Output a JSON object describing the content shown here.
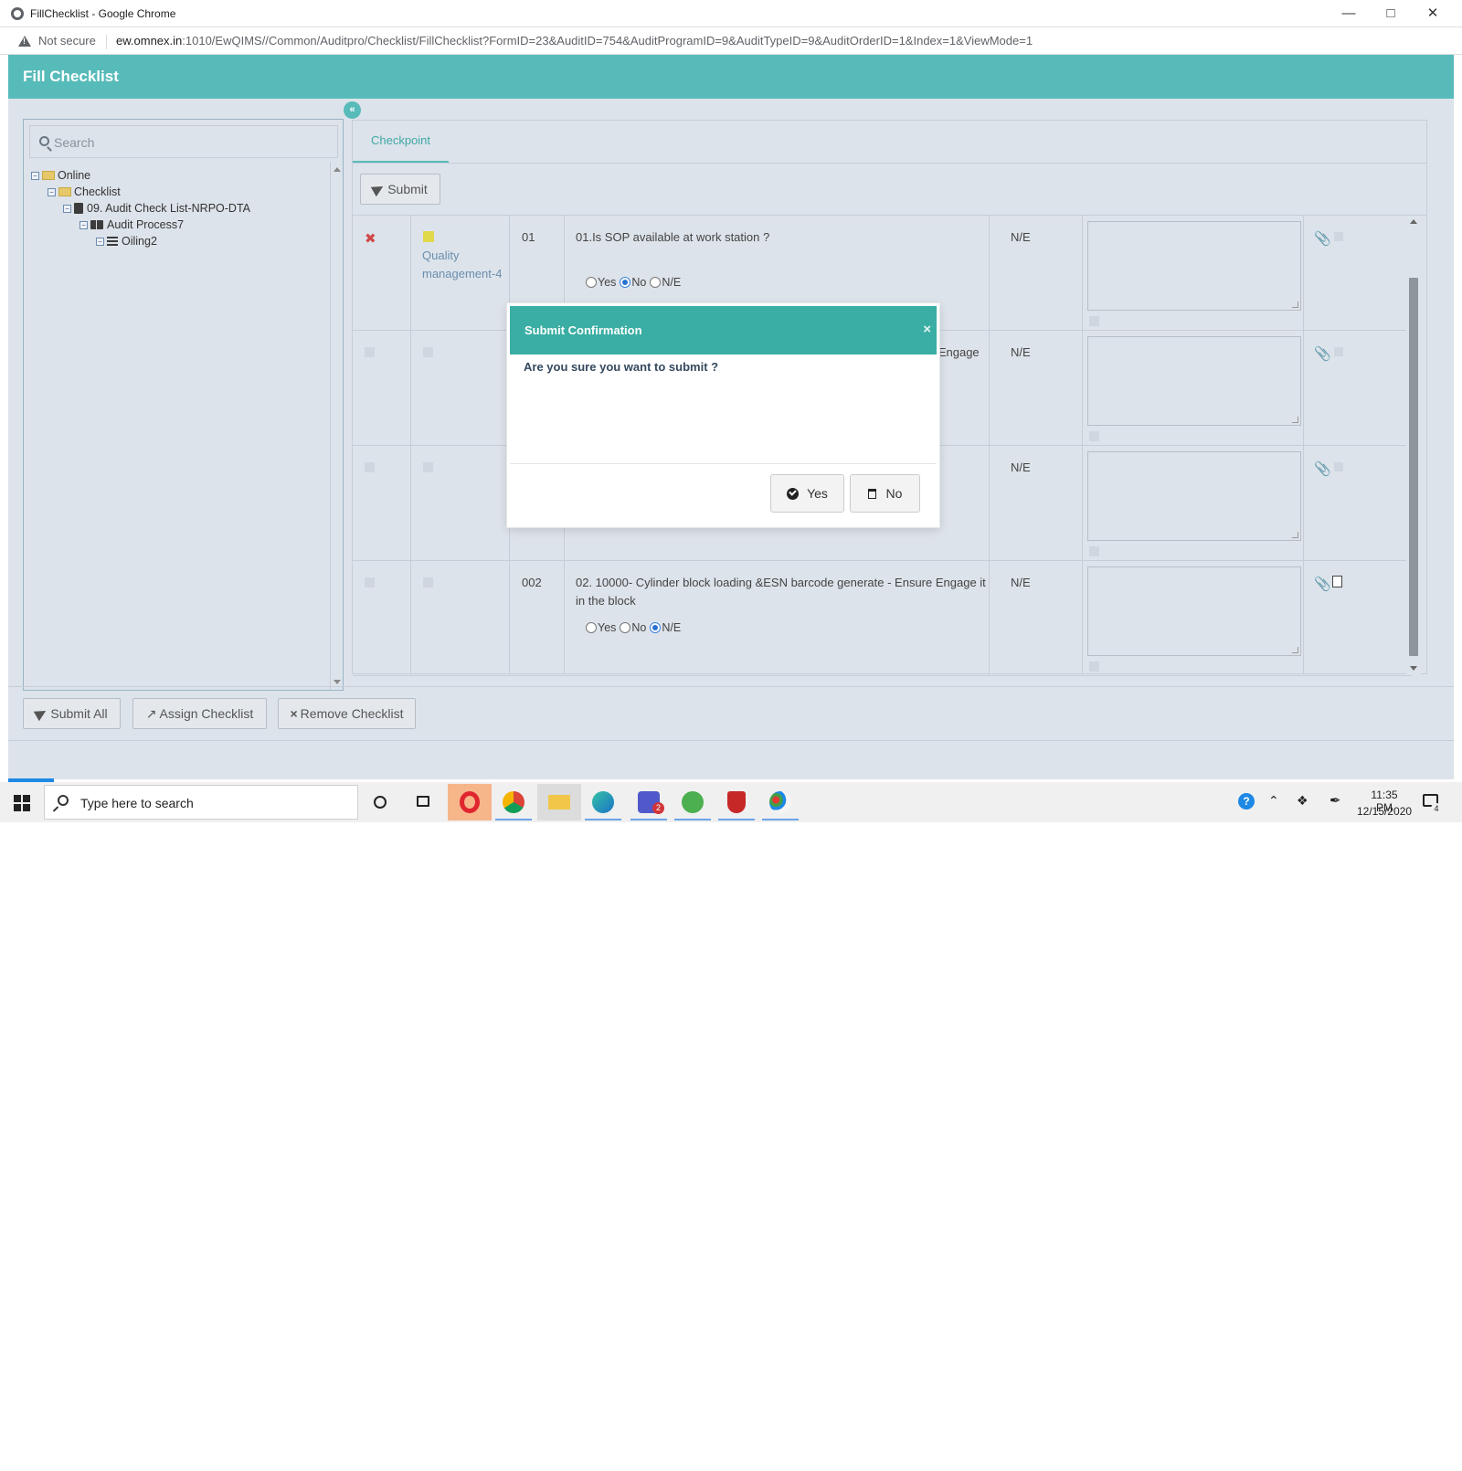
{
  "browser": {
    "window_title": "FillChecklist - Google Chrome",
    "security_label": "Not secure",
    "url_host": "ew.omnex.in",
    "url_rest": ":1010/EwQIMS//Common/Auditpro/Checklist/FillChecklist?FormID=23&AuditID=754&AuditProgramID=9&AuditTypeID=9&AuditOrderID=1&Index=1&ViewMode=1"
  },
  "app": {
    "title": "Fill Checklist",
    "collapse_glyph": "«",
    "accent_color": "#57bbba"
  },
  "sidebar": {
    "search_placeholder": "Search",
    "tree": [
      {
        "label": "Online",
        "icon": "folder-icon",
        "level": 0
      },
      {
        "label": "Checklist",
        "icon": "folder-icon",
        "level": 1
      },
      {
        "label": "09. Audit Check List-NRPO-DTA",
        "icon": "book-icon",
        "level": 2
      },
      {
        "label": "Audit Process7",
        "icon": "open-book-icon",
        "level": 3
      },
      {
        "label": "Oiling2",
        "icon": "list-icon",
        "level": 4
      }
    ]
  },
  "main": {
    "tab_label": "Checkpoint",
    "submit_label": "Submit",
    "rows": [
      {
        "seq": "01",
        "category": "Quality management-4",
        "question": "01.Is SOP available at work station ?",
        "status": "N/E",
        "selected": "No"
      },
      {
        "seq": "",
        "category": "",
        "question": "e Engage",
        "status": "N/E",
        "selected": ""
      },
      {
        "seq": "",
        "category": "",
        "question": "",
        "status": "N/E",
        "selected": ""
      },
      {
        "seq": "002",
        "category": "",
        "question": "02. 10000- Cylinder block loading &ESN barcode generate - Ensure Engage it in the block",
        "status": "N/E",
        "selected": "N/E"
      }
    ],
    "radio_labels": {
      "yes": "Yes",
      "no": "No",
      "ne": "N/E"
    }
  },
  "footer": {
    "submit_all": "Submit All",
    "assign_checklist": "Assign Checklist",
    "remove_checklist": "Remove Checklist"
  },
  "modal": {
    "title": "Submit Confirmation",
    "close": "×",
    "message": "Are you sure you want to submit ?",
    "yes_label": "Yes",
    "no_label": "No",
    "header_color": "#3aaea4"
  },
  "taskbar": {
    "search_placeholder": "Type here to search",
    "time": "11:35 PM",
    "date": "12/15/2020",
    "notification_count": "4",
    "teams_badge": "2"
  }
}
